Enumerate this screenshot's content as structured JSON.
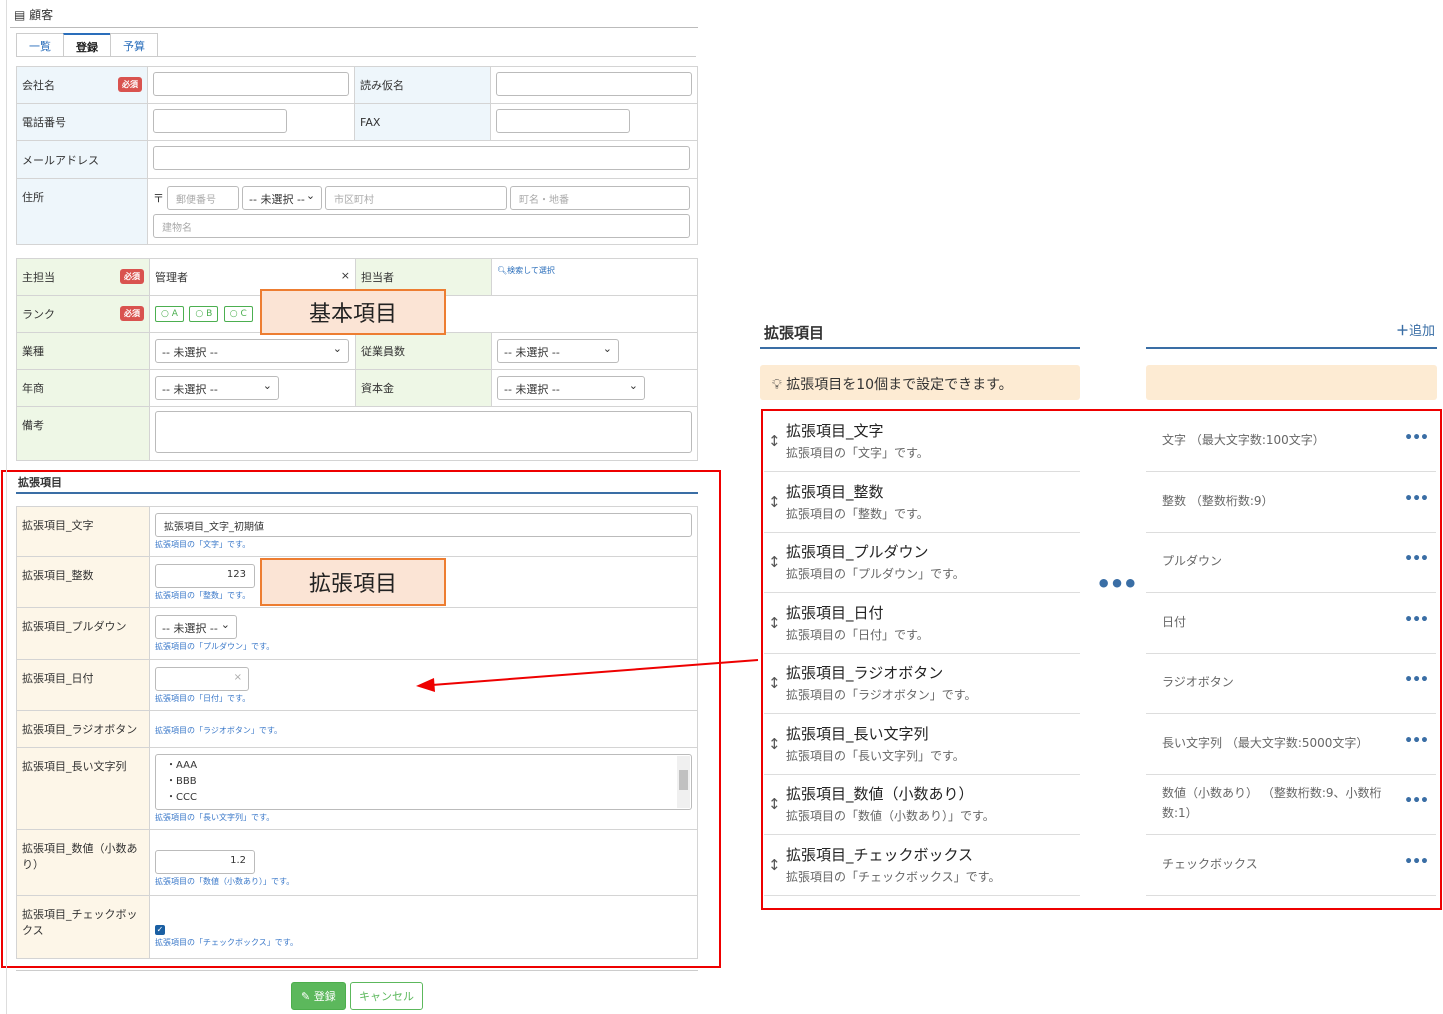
{
  "window": {
    "title": "顧客"
  },
  "tabs": [
    {
      "label": "一覧"
    },
    {
      "label": "登録"
    },
    {
      "label": "予算"
    }
  ],
  "basic": {
    "company_label": "会社名",
    "required": "必須",
    "kana_label": "読み仮名",
    "phone_label": "電話番号",
    "fax_label": "FAX",
    "email_label": "メールアドレス",
    "address_label": "住所",
    "postal_mark": "〒",
    "postal_ph": "郵便番号",
    "pref_select": "-- 未選択 --",
    "city_ph": "市区町村",
    "street_ph": "町名・地番",
    "building_ph": "建物名",
    "main_rep_label": "主担当",
    "main_rep_value": "管理者",
    "clear": "×",
    "rep_label": "担当者",
    "search_select": "検索して選択",
    "rank_label": "ランク",
    "rank_options": [
      "A",
      "B",
      "C"
    ],
    "industry_label": "業種",
    "industry_select": "-- 未選択 --",
    "employees_label": "従業員数",
    "employees_select": "-- 未選択 --",
    "revenue_label": "年商",
    "revenue_select": "-- 未選択 --",
    "capital_label": "資本金",
    "capital_select": "-- 未選択 --",
    "note_label": "備考"
  },
  "callout_basic": "基本項目",
  "callout_ext": "拡張項目",
  "ext_section": {
    "title": "拡張項目",
    "rows": [
      {
        "label": "拡張項目_文字",
        "value": "拡張項目_文字_初期値",
        "hint": "拡張項目の「文字」です。"
      },
      {
        "label": "拡張項目_整数",
        "value": "123",
        "hint": "拡張項目の「整数」です。"
      },
      {
        "label": "拡張項目_プルダウン",
        "value": "-- 未選択 --",
        "hint": "拡張項目の「プルダウン」です。"
      },
      {
        "label": "拡張項目_日付",
        "value": "×",
        "hint": "拡張項目の「日付」です。"
      },
      {
        "label": "拡張項目_ラジオボタン",
        "hint": "拡張項目の「ラジオボタン」です。"
      },
      {
        "label": "拡張項目_長い文字列",
        "lines": [
          "・AAA",
          "・BBB",
          "・CCC"
        ],
        "hint": "拡張項目の「長い文字列」です。"
      },
      {
        "label": "拡張項目_数値（小数あり）",
        "value": "1.2",
        "hint": "拡張項目の「数値（小数あり）」です。"
      },
      {
        "label": "拡張項目_チェックボックス",
        "hint": "拡張項目の「チェックボックス」です。"
      }
    ]
  },
  "buttons": {
    "save": "登録",
    "cancel": "キャンセル"
  },
  "right_panel": {
    "title": "拡張項目",
    "add": "追加",
    "notice": "拡張項目を10個まで設定できます。",
    "items": [
      {
        "name": "拡張項目_文字",
        "desc": "拡張項目の「文字」です。",
        "type": "文字 （最大文字数:100文字）"
      },
      {
        "name": "拡張項目_整数",
        "desc": "拡張項目の「整数」です。",
        "type": "整数 （整数桁数:9）"
      },
      {
        "name": "拡張項目_プルダウン",
        "desc": "拡張項目の「プルダウン」です。",
        "type": "プルダウン"
      },
      {
        "name": "拡張項目_日付",
        "desc": "拡張項目の「日付」です。",
        "type": "日付"
      },
      {
        "name": "拡張項目_ラジオボタン",
        "desc": "拡張項目の「ラジオボタン」です。",
        "type": "ラジオボタン"
      },
      {
        "name": "拡張項目_長い文字列",
        "desc": "拡張項目の「長い文字列」です。",
        "type": "長い文字列 （最大文字数:5000文字）"
      },
      {
        "name": "拡張項目_数値（小数あり）",
        "desc": "拡張項目の「数値（小数あり）」です。",
        "type": "数値（小数あり） （整数桁数:9、小数桁数:1）"
      },
      {
        "name": "拡張項目_チェックボックス",
        "desc": "拡張項目の「チェックボックス」です。",
        "type": "チェックボックス"
      }
    ]
  },
  "colors": {
    "red_frame": "#e00000",
    "callout_fill": "#fbe4d5",
    "callout_border": "#ed7d31",
    "accent": "#3a6ea5"
  }
}
